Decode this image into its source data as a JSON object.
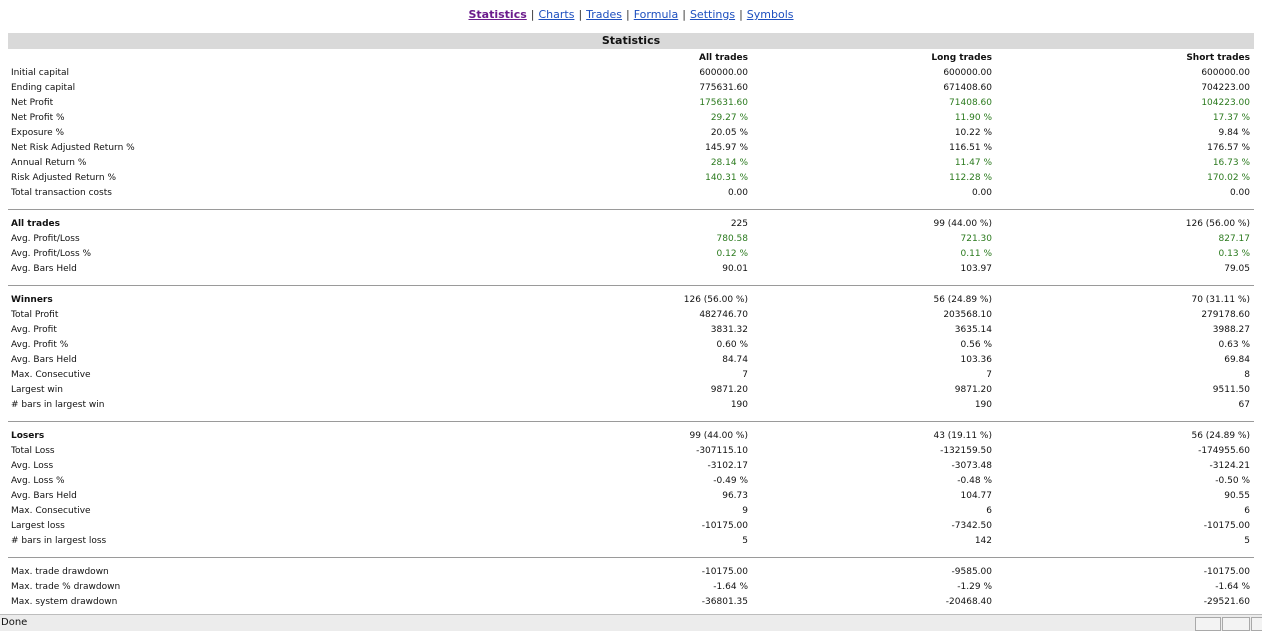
{
  "nav": [
    {
      "label": "Statistics",
      "active": true
    },
    {
      "label": "Charts",
      "active": false
    },
    {
      "label": "Trades",
      "active": false
    },
    {
      "label": "Formula",
      "active": false
    },
    {
      "label": "Settings",
      "active": false
    },
    {
      "label": "Symbols",
      "active": false
    }
  ],
  "section_title": "Statistics",
  "columns": [
    "All trades",
    "Long trades",
    "Short trades"
  ],
  "colors": {
    "positive": "#2b7a1e",
    "header_bg": "#d9d9d9",
    "link": "#1d4fbf",
    "active_link": "#6b1b8c"
  },
  "groups": [
    {
      "title": "",
      "rows": [
        {
          "label": "Initial capital",
          "values": [
            "600000.00",
            "600000.00",
            "600000.00"
          ],
          "green": false
        },
        {
          "label": "Ending capital",
          "values": [
            "775631.60",
            "671408.60",
            "704223.00"
          ],
          "green": false
        },
        {
          "label": "Net Profit",
          "values": [
            "175631.60",
            "71408.60",
            "104223.00"
          ],
          "green": true
        },
        {
          "label": "Net Profit %",
          "values": [
            "29.27 %",
            "11.90 %",
            "17.37 %"
          ],
          "green": true
        },
        {
          "label": "Exposure %",
          "values": [
            "20.05 %",
            "10.22 %",
            "9.84 %"
          ],
          "green": false
        },
        {
          "label": "Net Risk Adjusted Return %",
          "values": [
            "145.97 %",
            "116.51 %",
            "176.57 %"
          ],
          "green": false
        },
        {
          "label": "Annual Return %",
          "values": [
            "28.14 %",
            "11.47 %",
            "16.73 %"
          ],
          "green": true
        },
        {
          "label": "Risk Adjusted Return %",
          "values": [
            "140.31 %",
            "112.28 %",
            "170.02 %"
          ],
          "green": true
        },
        {
          "label": "Total transaction costs",
          "values": [
            "0.00",
            "0.00",
            "0.00"
          ],
          "green": false
        }
      ]
    },
    {
      "title": "All trades",
      "title_values": [
        "225",
        "99 (44.00 %)",
        "126 (56.00 %)"
      ],
      "rows": [
        {
          "label": "Avg. Profit/Loss",
          "values": [
            "780.58",
            "721.30",
            "827.17"
          ],
          "green": true
        },
        {
          "label": "Avg. Profit/Loss %",
          "values": [
            "0.12 %",
            "0.11 %",
            "0.13 %"
          ],
          "green": true
        },
        {
          "label": "Avg. Bars Held",
          "values": [
            "90.01",
            "103.97",
            "79.05"
          ],
          "green": false
        }
      ]
    },
    {
      "title": "Winners",
      "title_values": [
        "126 (56.00 %)",
        "56 (24.89 %)",
        "70 (31.11 %)"
      ],
      "rows": [
        {
          "label": "Total Profit",
          "values": [
            "482746.70",
            "203568.10",
            "279178.60"
          ],
          "green": false
        },
        {
          "label": "Avg. Profit",
          "values": [
            "3831.32",
            "3635.14",
            "3988.27"
          ],
          "green": false
        },
        {
          "label": "Avg. Profit %",
          "values": [
            "0.60 %",
            "0.56 %",
            "0.63 %"
          ],
          "green": false
        },
        {
          "label": "Avg. Bars Held",
          "values": [
            "84.74",
            "103.36",
            "69.84"
          ],
          "green": false
        },
        {
          "label": "Max. Consecutive",
          "values": [
            "7",
            "7",
            "8"
          ],
          "green": false
        },
        {
          "label": "Largest win",
          "values": [
            "9871.20",
            "9871.20",
            "9511.50"
          ],
          "green": false
        },
        {
          "label": "# bars in largest win",
          "values": [
            "190",
            "190",
            "67"
          ],
          "green": false
        }
      ]
    },
    {
      "title": "Losers",
      "title_values": [
        "99 (44.00 %)",
        "43 (19.11 %)",
        "56 (24.89 %)"
      ],
      "rows": [
        {
          "label": "Total Loss",
          "values": [
            "-307115.10",
            "-132159.50",
            "-174955.60"
          ],
          "green": false
        },
        {
          "label": "Avg. Loss",
          "values": [
            "-3102.17",
            "-3073.48",
            "-3124.21"
          ],
          "green": false
        },
        {
          "label": "Avg. Loss %",
          "values": [
            "-0.49 %",
            "-0.48 %",
            "-0.50 %"
          ],
          "green": false
        },
        {
          "label": "Avg. Bars Held",
          "values": [
            "96.73",
            "104.77",
            "90.55"
          ],
          "green": false
        },
        {
          "label": "Max. Consecutive",
          "values": [
            "9",
            "6",
            "6"
          ],
          "green": false
        },
        {
          "label": "Largest loss",
          "values": [
            "-10175.00",
            "-7342.50",
            "-10175.00"
          ],
          "green": false
        },
        {
          "label": "# bars in largest loss",
          "values": [
            "5",
            "142",
            "5"
          ],
          "green": false
        }
      ]
    },
    {
      "title": "",
      "rows": [
        {
          "label": "Max. trade drawdown",
          "values": [
            "-10175.00",
            "-9585.00",
            "-10175.00"
          ],
          "green": false
        },
        {
          "label": "Max. trade % drawdown",
          "values": [
            "-1.64 %",
            "-1.29 %",
            "-1.64 %"
          ],
          "green": false
        },
        {
          "label": "Max. system drawdown",
          "values": [
            "-36801.35",
            "-20468.40",
            "-29521.60"
          ],
          "green": false
        }
      ]
    }
  ],
  "status": {
    "text": "Done"
  }
}
